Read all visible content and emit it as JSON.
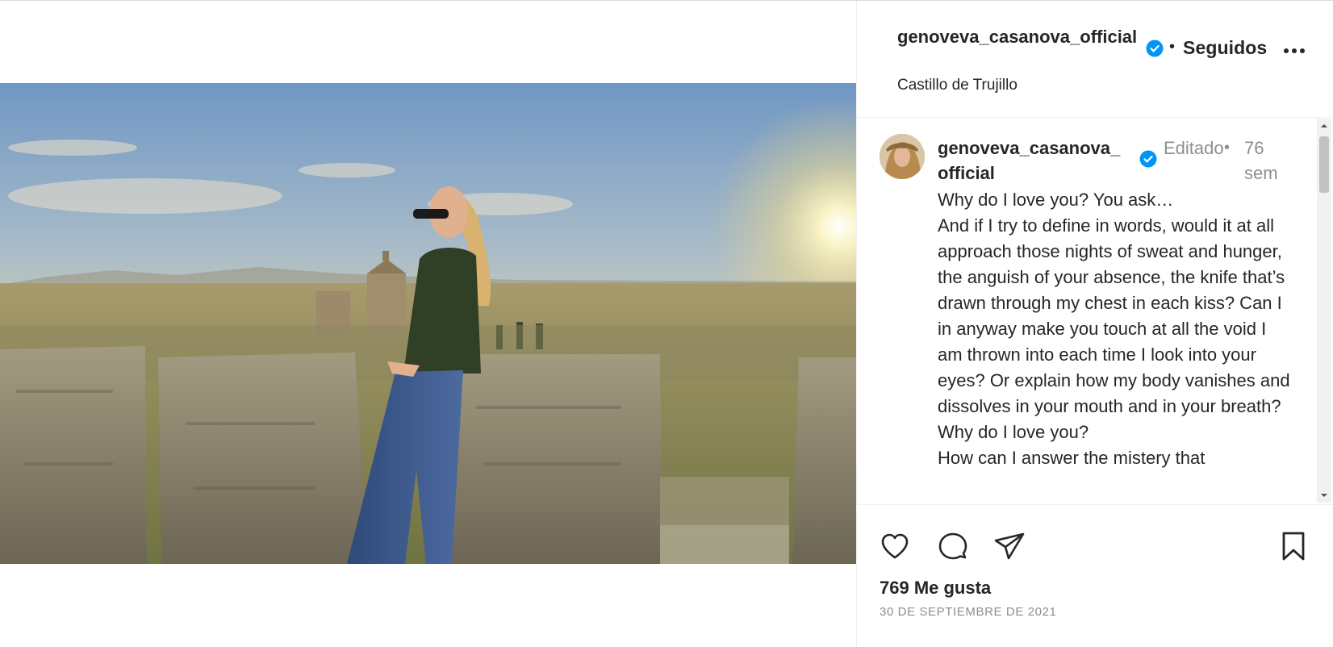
{
  "post": {
    "image_alt": "Woman leaning on castle battlements at sunset",
    "colors": {
      "verified": "#0095f6",
      "text": "#262626",
      "muted": "#8e8e8e"
    }
  },
  "header": {
    "username": "genoveva_casanova_official",
    "separator": "•",
    "follow_status": "Seguidos",
    "location": "Castillo de Trujillo",
    "more_icon": "more-horizontal-icon"
  },
  "caption": {
    "username": "genoveva_casanova_official",
    "edited": "Editado",
    "separator": "•",
    "time": "76 sem",
    "text": "Why do I love you? You ask…\nAnd if I try to define in words, would it at all approach those nights of sweat and hunger, the anguish of your absence, the knife that’s drawn through my chest in each kiss? Can I in anyway make you touch at all the void I am thrown into each time I look into your eyes? Or explain how my body vanishes and dissolves in your mouth and in your breath?\nWhy do I love you?\nHow can I answer the mistery that"
  },
  "actions": {
    "icons": [
      "heart-icon",
      "comment-icon",
      "share-icon",
      "bookmark-icon"
    ],
    "likes": "769 Me gusta",
    "date": "30 DE SEPTIEMBRE DE 2021"
  }
}
